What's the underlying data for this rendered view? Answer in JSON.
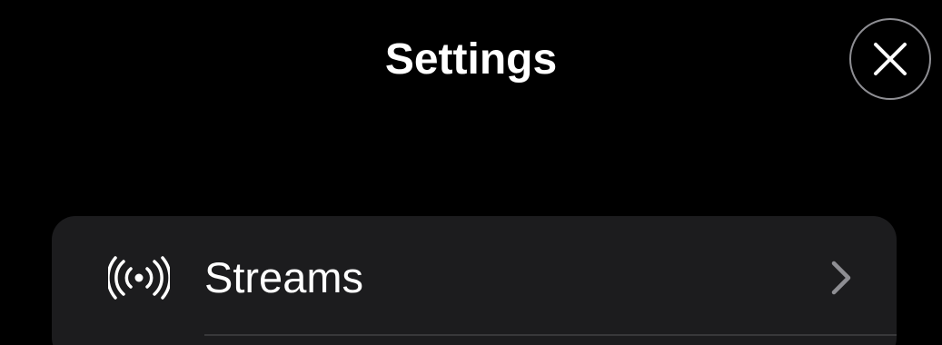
{
  "header": {
    "title": "Settings",
    "close_icon": "close-icon"
  },
  "settings_list": {
    "items": [
      {
        "label": "Streams",
        "icon": "broadcast-icon",
        "accessory": "chevron-right-icon"
      }
    ]
  },
  "colors": {
    "background": "#000000",
    "card": "#1c1c1e",
    "text": "#ffffff",
    "chevron": "#8e8e93",
    "divider": "#38383a"
  }
}
